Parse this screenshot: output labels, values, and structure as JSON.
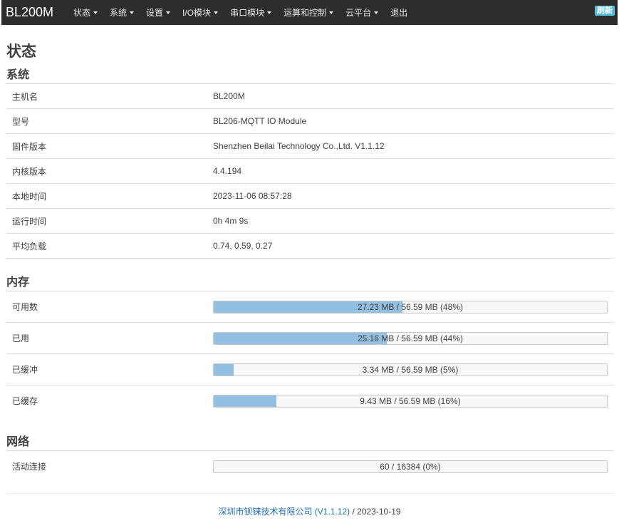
{
  "navbar": {
    "brand": "BL200M",
    "menu": [
      {
        "label": "状态",
        "dropdown": true
      },
      {
        "label": "系统",
        "dropdown": true
      },
      {
        "label": "设置",
        "dropdown": true
      },
      {
        "label": "I/O模块",
        "dropdown": true
      },
      {
        "label": "串口模块",
        "dropdown": true
      },
      {
        "label": "运算和控制",
        "dropdown": true
      },
      {
        "label": "云平台",
        "dropdown": true
      },
      {
        "label": "退出",
        "dropdown": false
      }
    ],
    "refresh_label": "刷新"
  },
  "page_title": "状态",
  "system": {
    "heading": "系统",
    "rows": [
      {
        "label": "主机名",
        "value": "BL200M"
      },
      {
        "label": "型号",
        "value": "BL206-MQTT IO Module"
      },
      {
        "label": "固件版本",
        "value": "Shenzhen Beilai Technology Co.,Ltd. V1.1.12"
      },
      {
        "label": "内核版本",
        "value": "4.4.194"
      },
      {
        "label": "本地时间",
        "value": "2023-11-06 08:57:28"
      },
      {
        "label": "运行时间",
        "value": "0h 4m 9s"
      },
      {
        "label": "平均负载",
        "value": "0.74, 0.59, 0.27"
      }
    ]
  },
  "memory": {
    "heading": "内存",
    "rows": [
      {
        "label": "可用数",
        "text": "27.23 MB / 56.59 MB (48%)",
        "percent": 48
      },
      {
        "label": "已用",
        "text": "25.16 MB / 56.59 MB (44%)",
        "percent": 44
      },
      {
        "label": "已缓冲",
        "text": "3.34 MB / 56.59 MB (5%)",
        "percent": 5
      },
      {
        "label": "已缓存",
        "text": "9.43 MB / 56.59 MB (16%)",
        "percent": 16
      }
    ]
  },
  "network": {
    "heading": "网络",
    "rows": [
      {
        "label": "活动连接",
        "text": "60 / 16384 (0%)",
        "percent": 0
      }
    ]
  },
  "footer": {
    "link_text": "深圳市钡铼技术有限公司 (V1.1.12)",
    "suffix": " / 2023-10-19"
  },
  "colors": {
    "navbar_bg": "#2d2d2d",
    "bar_fill": "#93c0e0",
    "refresh_bg": "#5bc0de",
    "link": "#1f6fb2"
  }
}
